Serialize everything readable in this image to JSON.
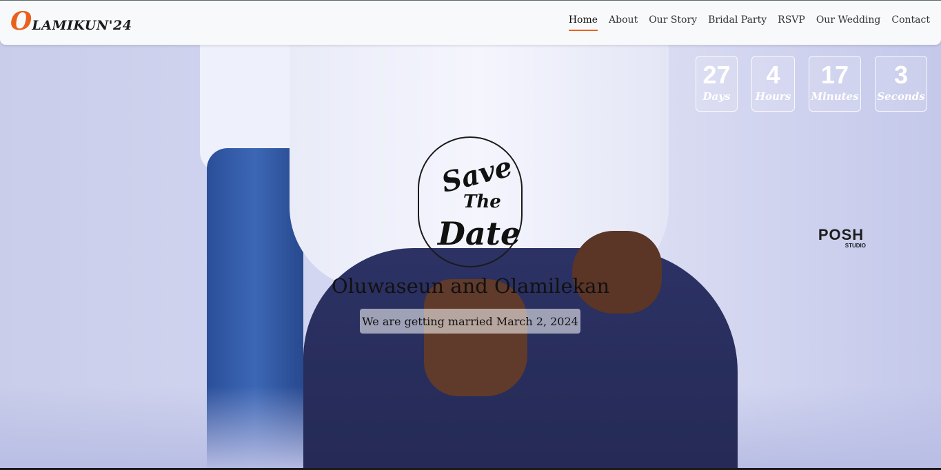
{
  "brand": {
    "initial": "O",
    "rest": "LAMIKUN'24",
    "accent_color": "#e8621c"
  },
  "nav": {
    "items": [
      {
        "label": "Home",
        "active": true
      },
      {
        "label": "About",
        "active": false
      },
      {
        "label": "Our Story",
        "active": false
      },
      {
        "label": "Bridal Party",
        "active": false
      },
      {
        "label": "RSVP",
        "active": false
      },
      {
        "label": "Our Wedding",
        "active": false
      },
      {
        "label": "Contact",
        "active": false
      }
    ]
  },
  "countdown": [
    {
      "value": "27",
      "label": "Days"
    },
    {
      "value": "4",
      "label": "Hours"
    },
    {
      "value": "17",
      "label": "Minutes"
    },
    {
      "value": "3",
      "label": "Seconds"
    }
  ],
  "hero": {
    "save_the_date": {
      "line1": "Save",
      "line2": "The",
      "line3": "Date"
    },
    "couple": "Oluwaseun and Olamilekan",
    "tagline": "We are getting married March 2, 2024",
    "watermark": {
      "main": "POSH",
      "sub": "STUDIO"
    }
  }
}
